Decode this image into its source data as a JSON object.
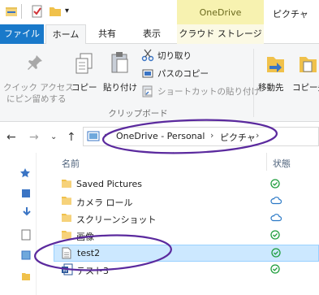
{
  "title_bar": {
    "context_tab_group": "OneDrive",
    "window_title": "ピクチャ"
  },
  "tabs": {
    "file": "ファイル",
    "home": "ホーム",
    "share": "共有",
    "view": "表示",
    "cloud_storage": "クラウド ストレージ"
  },
  "ribbon": {
    "pin_quick_access_line1": "クイック アクセス",
    "pin_quick_access_line2": "にピン留めする",
    "copy": "コピー",
    "paste": "貼り付け",
    "cut": "切り取り",
    "copy_path": "パスのコピー",
    "paste_shortcut": "ショートカットの貼り付け",
    "clipboard_group": "クリップボード",
    "move_to": "移動先",
    "copy_to": "コピー先"
  },
  "address_bar": {
    "crumbs": [
      "OneDrive - Personal",
      "ピクチャ"
    ]
  },
  "columns": {
    "name": "名前",
    "status": "状態"
  },
  "files": [
    {
      "name": "Saved Pictures",
      "kind": "folder",
      "status": "synced-check"
    },
    {
      "name": "カメラ ロール",
      "kind": "folder",
      "status": "cloud"
    },
    {
      "name": "スクリーンショット",
      "kind": "folder",
      "status": "cloud"
    },
    {
      "name": "画像",
      "kind": "folder",
      "status": "synced-check"
    },
    {
      "name": "test2",
      "kind": "text-file",
      "status": "synced-check",
      "selected": true
    },
    {
      "name": "テスト3",
      "kind": "word-file",
      "status": "synced-check"
    }
  ],
  "colors": {
    "file_tab": "#1979ca",
    "onedrive_context": "#f7f2b0",
    "selection": "#cce8ff",
    "annotation": "#5b2a9e",
    "synced_green": "#1f9e3d",
    "cloud_blue": "#2a78c6"
  }
}
